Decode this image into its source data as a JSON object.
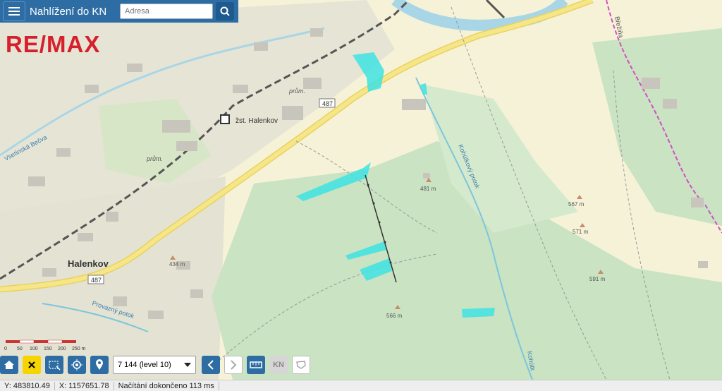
{
  "header": {
    "title": "Nahlížení do KN",
    "search_placeholder": "Adresa"
  },
  "logo": {
    "text": "RE/MAX"
  },
  "map_labels": {
    "station": "žst. Halenkov",
    "village": "Halenkov",
    "road_1": "487",
    "road_2": "487",
    "prum_1": "prům.",
    "prum_2": "prům.",
    "river": "Vsetínská Bečva",
    "stream_1": "Provazný potok",
    "stream_2": "Kohútkový potok",
    "stream_3": "Kohútk",
    "brezina": "Břežiňa",
    "elev_1": "434 m",
    "elev_2": "481 m",
    "elev_3": "567 m",
    "elev_4": "571 m",
    "elev_5": "591 m",
    "elev_6": "566 m"
  },
  "scale": {
    "labels": [
      "0",
      "50",
      "100",
      "150",
      "200",
      "250 m"
    ]
  },
  "toolbar": {
    "level_value": "7 144 (level 10)",
    "kn_label": "KN"
  },
  "status": {
    "y": "Y: 483810.49",
    "x": "X: 1157651.78",
    "loading": "Načítání dokončeno 113 ms"
  },
  "colors": {
    "header": "#2d6da3",
    "parcel_highlight": "#3fe3e3",
    "road": "#f2dd6e",
    "forest": "#c9e3c3",
    "field": "#f7f3d3"
  }
}
